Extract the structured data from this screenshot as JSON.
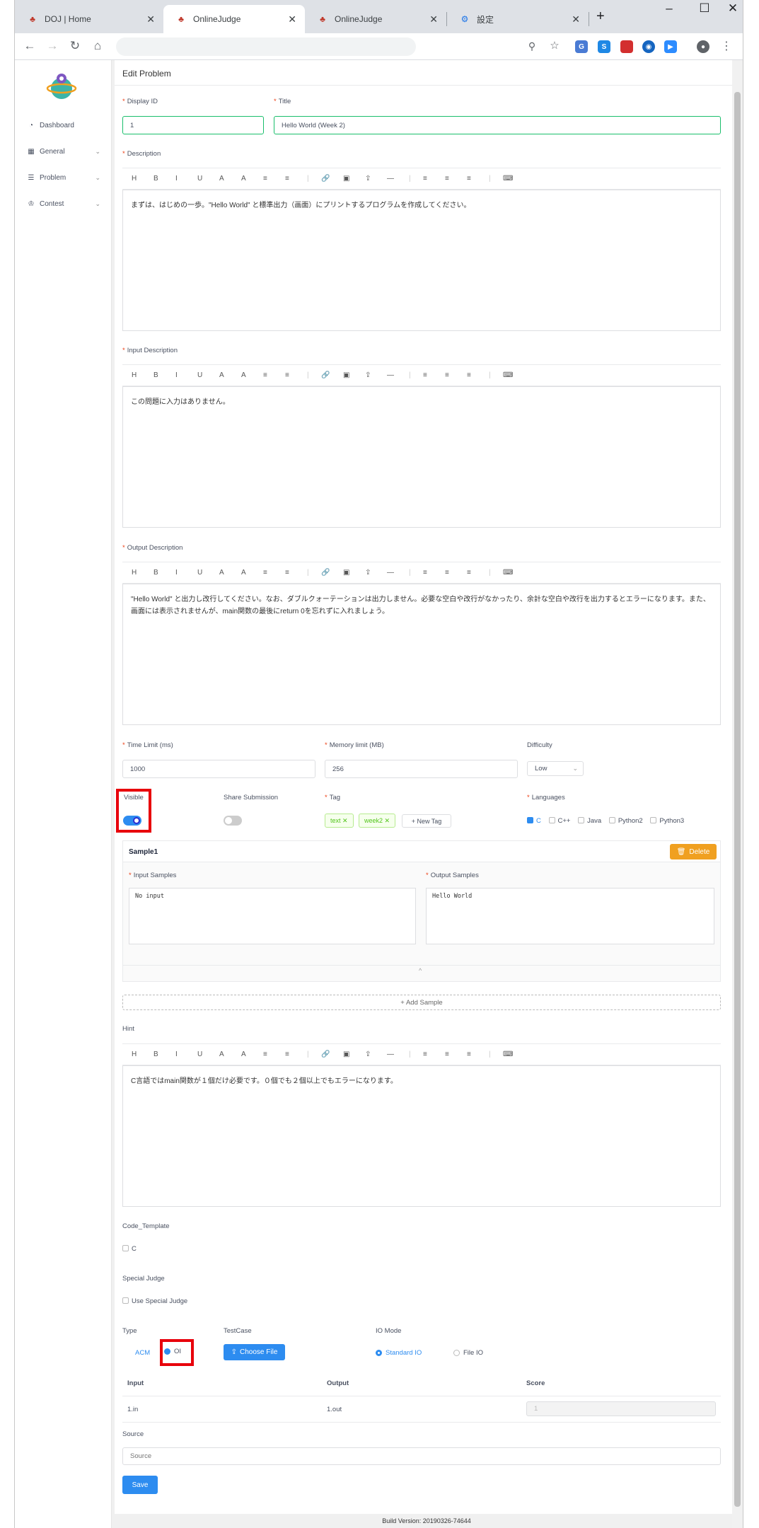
{
  "browser": {
    "tabs": [
      {
        "title": "DOJ | Home",
        "active": false,
        "favicon": "tree-icon"
      },
      {
        "title": "OnlineJudge",
        "active": true,
        "favicon": "tree-icon"
      },
      {
        "title": "OnlineJudge",
        "active": false,
        "favicon": "tree-icon"
      },
      {
        "title": "設定",
        "active": false,
        "favicon": "gear-icon"
      }
    ],
    "new_tab_glyph": "+",
    "url": ""
  },
  "sidebar": {
    "items": [
      {
        "label": "Dashboard",
        "icon": "dashboard-icon",
        "has_chevron": false
      },
      {
        "label": "General",
        "icon": "grid-icon",
        "has_chevron": true
      },
      {
        "label": "Problem",
        "icon": "list-icon",
        "has_chevron": true
      },
      {
        "label": "Contest",
        "icon": "trophy-icon",
        "has_chevron": true
      }
    ]
  },
  "page": {
    "title": "Edit Problem",
    "display_id_label": "Display ID",
    "display_id_value": "1",
    "title_label": "Title",
    "title_value": "Hello World (Week 2)",
    "description_label": "Description",
    "description_text": "まずは、はじめの一歩。\"Hello World\" と標準出力（画面）にプリントするプログラムを作成してください。",
    "input_desc_label": "Input Description",
    "input_desc_text": "この問題に入力はありません。",
    "output_desc_label": "Output Description",
    "output_desc_text": "\"Hello World\" と出力し改行してください。なお、ダブルクォーテーションは出力しません。必要な空白や改行がなかったり、余計な空白や改行を出力するとエラーになります。また、画面には表示されませんが、main関数の最後にreturn 0を忘れずに入れましょう。",
    "time_limit_label": "Time Limit (ms)",
    "time_limit_value": "1000",
    "memory_limit_label": "Memory limit (MB)",
    "memory_limit_value": "256",
    "difficulty_label": "Difficulty",
    "difficulty_value": "Low",
    "visible_label": "Visible",
    "visible_on": true,
    "share_label": "Share Submission",
    "share_on": false,
    "tag_label": "Tag",
    "tags": [
      "text",
      "week2"
    ],
    "new_tag_label": "+ New Tag",
    "languages_label": "Languages",
    "languages": [
      {
        "name": "C",
        "checked": true
      },
      {
        "name": "C++",
        "checked": false
      },
      {
        "name": "Java",
        "checked": false
      },
      {
        "name": "Python2",
        "checked": false
      },
      {
        "name": "Python3",
        "checked": false
      }
    ],
    "sample_title": "Sample1",
    "delete_label": "Delete",
    "input_samples_label": "Input Samples",
    "input_samples_value": "No input",
    "output_samples_label": "Output Samples",
    "output_samples_value": "Hello World",
    "collapse_glyph": "^",
    "add_sample_label": "+ Add Sample",
    "hint_label": "Hint",
    "hint_text": "C言語ではmain関数が１個だけ必要です。０個でも２個以上でもエラーになります。",
    "code_template_label": "Code_Template",
    "code_template_option": "C",
    "special_judge_label": "Special Judge",
    "use_special_judge_label": "Use Special Judge",
    "type_label": "Type",
    "type_options": [
      "ACM",
      "OI"
    ],
    "type_selected": "OI",
    "testcase_label": "TestCase",
    "choose_file_label": "Choose File",
    "io_mode_label": "IO Mode",
    "io_options": [
      "Standard IO",
      "File IO"
    ],
    "io_selected": "Standard IO",
    "table_headers": [
      "Input",
      "Output",
      "Score"
    ],
    "table_row": {
      "input": "1.in",
      "output": "1.out",
      "score": "1"
    },
    "source_label": "Source",
    "source_placeholder": "Source",
    "save_label": "Save",
    "build_version": "Build Version: 20190326-74644"
  },
  "editor_toolbar": [
    "H",
    "B",
    "I",
    "U",
    "A",
    "A",
    "≡",
    "≡",
    "|",
    "🔗",
    "▣",
    "⇪",
    "—",
    "|",
    "≡",
    "≡",
    "≡",
    "|",
    "⌨"
  ],
  "colors": {
    "primary": "#2d8cf0",
    "success": "#19be6b",
    "warning": "#f0a020",
    "highlight": "#e8000b"
  }
}
